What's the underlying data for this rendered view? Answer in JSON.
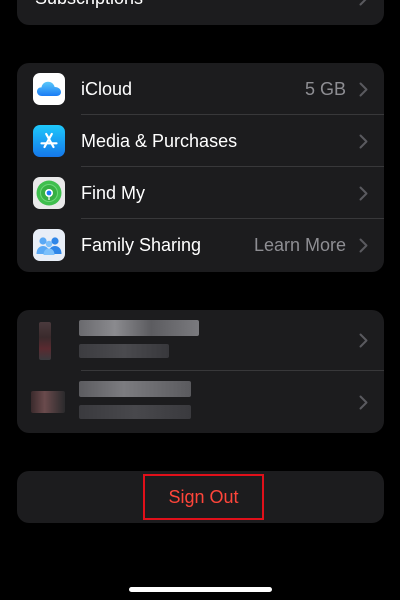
{
  "top_item": {
    "label": "Subscriptions"
  },
  "services": [
    {
      "label": "iCloud",
      "detail": "5 GB",
      "icon": "icloud-icon"
    },
    {
      "label": "Media & Purchases",
      "detail": "",
      "icon": "app-store-icon"
    },
    {
      "label": "Find My",
      "detail": "",
      "icon": "find-my-icon"
    },
    {
      "label": "Family Sharing",
      "detail": "Learn More",
      "icon": "family-sharing-icon"
    }
  ],
  "sign_out": {
    "label": "Sign Out"
  },
  "colors": {
    "background": "#000000",
    "card": "#1c1c1e",
    "separator": "#38383a",
    "secondary_text": "#8e8e93",
    "destructive": "#ff453a",
    "highlight_box": "#e0101a"
  }
}
